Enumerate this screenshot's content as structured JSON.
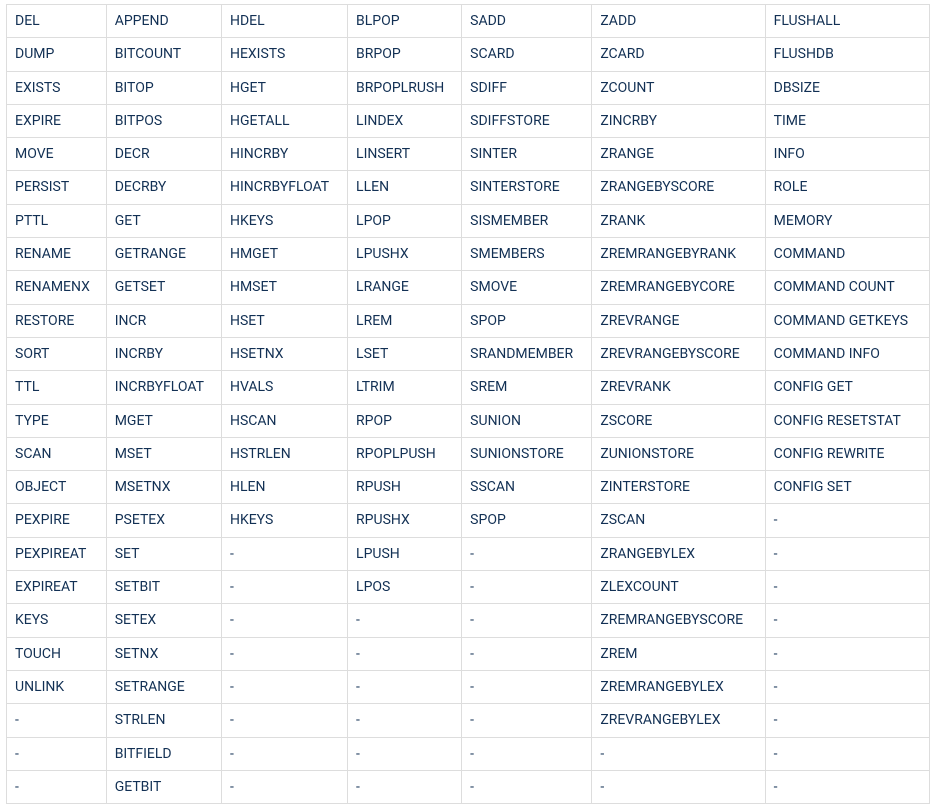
{
  "table": {
    "columns": 7,
    "rows": [
      [
        "DEL",
        "APPEND",
        "HDEL",
        "BLPOP",
        "SADD",
        "ZADD",
        "FLUSHALL"
      ],
      [
        "DUMP",
        "BITCOUNT",
        "HEXISTS",
        "BRPOP",
        "SCARD",
        "ZCARD",
        "FLUSHDB"
      ],
      [
        "EXISTS",
        "BITOP",
        "HGET",
        "BRPOPLRUSH",
        "SDIFF",
        "ZCOUNT",
        "DBSIZE"
      ],
      [
        "EXPIRE",
        "BITPOS",
        "HGETALL",
        "LINDEX",
        "SDIFFSTORE",
        "ZINCRBY",
        "TIME"
      ],
      [
        "MOVE",
        "DECR",
        "HINCRBY",
        "LINSERT",
        "SINTER",
        "ZRANGE",
        "INFO"
      ],
      [
        "PERSIST",
        "DECRBY",
        "HINCRBYFLOAT",
        "LLEN",
        "SINTERSTORE",
        "ZRANGEBYSCORE",
        "ROLE"
      ],
      [
        "PTTL",
        "GET",
        "HKEYS",
        "LPOP",
        "SISMEMBER",
        "ZRANK",
        "MEMORY"
      ],
      [
        "RENAME",
        "GETRANGE",
        "HMGET",
        "LPUSHX",
        "SMEMBERS",
        "ZREMRANGEBYRANK",
        "COMMAND"
      ],
      [
        "RENAMENX",
        "GETSET",
        "HMSET",
        "LRANGE",
        "SMOVE",
        "ZREMRANGEBYCORE",
        "COMMAND COUNT"
      ],
      [
        "RESTORE",
        "INCR",
        "HSET",
        "LREM",
        "SPOP",
        "ZREVRANGE",
        "COMMAND GETKEYS"
      ],
      [
        "SORT",
        "INCRBY",
        "HSETNX",
        "LSET",
        "SRANDMEMBER",
        "ZREVRANGEBYSCORE",
        "COMMAND INFO"
      ],
      [
        "TTL",
        "INCRBYFLOAT",
        "HVALS",
        "LTRIM",
        "SREM",
        "ZREVRANK",
        "CONFIG GET"
      ],
      [
        "TYPE",
        "MGET",
        "HSCAN",
        "RPOP",
        "SUNION",
        "ZSCORE",
        "CONFIG RESETSTAT"
      ],
      [
        "SCAN",
        "MSET",
        "HSTRLEN",
        "RPOPLPUSH",
        "SUNIONSTORE",
        "ZUNIONSTORE",
        "CONFIG REWRITE"
      ],
      [
        "OBJECT",
        "MSETNX",
        "HLEN",
        "RPUSH",
        "SSCAN",
        "ZINTERSTORE",
        "CONFIG SET"
      ],
      [
        "PEXPIRE",
        "PSETEX",
        "HKEYS",
        "RPUSHX",
        "SPOP",
        "ZSCAN",
        "-"
      ],
      [
        "PEXPIREAT",
        "SET",
        "-",
        "LPUSH",
        "-",
        "ZRANGEBYLEX",
        "-"
      ],
      [
        "EXPIREAT",
        "SETBIT",
        "-",
        "LPOS",
        "-",
        "ZLEXCOUNT",
        "-"
      ],
      [
        "KEYS",
        "SETEX",
        "-",
        "-",
        "-",
        "ZREMRANGEBYSCORE",
        "-"
      ],
      [
        "TOUCH",
        "SETNX",
        "-",
        "-",
        "-",
        "ZREM",
        "-"
      ],
      [
        "UNLINK",
        "SETRANGE",
        "-",
        "-",
        "-",
        "ZREMRANGEBYLEX",
        "-"
      ],
      [
        "-",
        "STRLEN",
        "-",
        "-",
        "-",
        "ZREVRANGEBYLEX",
        "-"
      ],
      [
        "-",
        "BITFIELD",
        "-",
        "-",
        "-",
        "-",
        "-"
      ],
      [
        "-",
        "GETBIT",
        "-",
        "-",
        "-",
        "-",
        "-"
      ]
    ]
  }
}
